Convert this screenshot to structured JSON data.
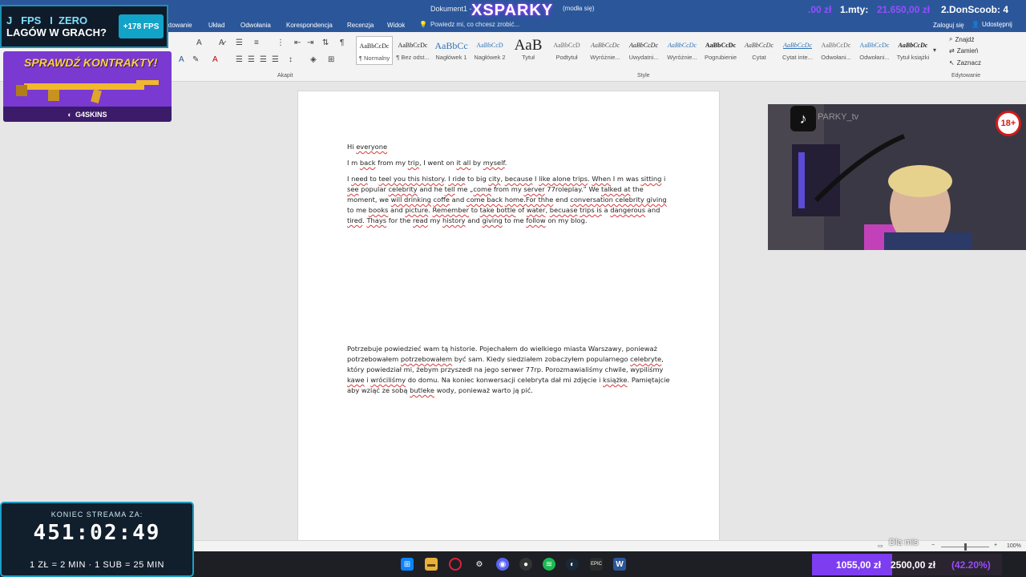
{
  "window": {
    "doc_title": "Dokument1 -",
    "doc_title_suffix": "(modła się)",
    "brand_overlay": "XSPARKY"
  },
  "ribbon_tabs": [
    {
      "label": "ktowanie"
    },
    {
      "label": "Układ"
    },
    {
      "label": "Odwołania"
    },
    {
      "label": "Korespondencja"
    },
    {
      "label": "Recenzja"
    },
    {
      "label": "Widok"
    }
  ],
  "tellme_placeholder": "Powiedz mi, co chcesz zrobić...",
  "account": {
    "login": "Zaloguj się",
    "share": "Udostępnij"
  },
  "ribbon_groups": {
    "paragraph": "Akapit",
    "styles": "Style",
    "editing": "Edytowanie"
  },
  "styles": [
    {
      "sample": "AaBbCcDc",
      "name": "¶ Normalny"
    },
    {
      "sample": "AaBbCcDc",
      "name": "¶ Bez odst..."
    },
    {
      "sample": "AaBbCc",
      "name": "Nagłówek 1"
    },
    {
      "sample": "AaBbCcD",
      "name": "Nagłówek 2"
    },
    {
      "sample": "AaB",
      "name": "Tytuł"
    },
    {
      "sample": "AaBbCcD",
      "name": "Podtytuł"
    },
    {
      "sample": "AaBbCcDc",
      "name": "Wyróżnie..."
    },
    {
      "sample": "AaBbCcDc",
      "name": "Uwydatni..."
    },
    {
      "sample": "AaBbCcDc",
      "name": "Wyróżnie..."
    },
    {
      "sample": "AaBbCcDc",
      "name": "Pogrubienie"
    },
    {
      "sample": "AaBbCcDc",
      "name": "Cytat"
    },
    {
      "sample": "AaBbCcDc",
      "name": "Cytat inte..."
    },
    {
      "sample": "AaBbCcDc",
      "name": "Odwołani..."
    },
    {
      "sample": "AaBbCcDc",
      "name": "Odwołani..."
    },
    {
      "sample": "AaBbCcDc",
      "name": "Tytuł książki"
    }
  ],
  "editing": {
    "find": "Znajdź",
    "replace": "Zamień",
    "select": "Zaznacz"
  },
  "document": {
    "p1": [
      "Hi ",
      {
        "t": "everyone",
        "sq": true
      }
    ],
    "p2": [
      "I m ",
      {
        "t": "back",
        "sq": true
      },
      " from my ",
      {
        "t": "trip",
        "sq": true
      },
      ", I went on ",
      {
        "t": "it all",
        "sq": true
      },
      " by ",
      {
        "t": "myself",
        "sq": true
      },
      "."
    ],
    "p3": [
      "I ",
      {
        "t": "need",
        "sq": true
      },
      " to ",
      {
        "t": "teel you this history",
        "sq": true
      },
      ". ",
      {
        "t": "I ride",
        "sq": true
      },
      " to big ",
      {
        "t": "city",
        "sq": true
      },
      ", ",
      {
        "t": "because",
        "sq": true
      },
      " I ",
      {
        "t": "like alone trips",
        "sq": true
      },
      ". ",
      {
        "t": "When",
        "sq": true
      },
      " I m was ",
      {
        "t": "sitting",
        "sq": true
      },
      " i ",
      {
        "t": "see",
        "sq": true
      },
      " popular ",
      {
        "t": "celebrity",
        "sq": true
      },
      " and he ",
      {
        "t": "tell",
        "sq": true
      },
      " me „",
      {
        "t": "come",
        "sq": true
      },
      " from my ",
      {
        "t": "server",
        "sq": true
      },
      " 77roleplay.” We ",
      {
        "t": "talked at",
        "sq": true
      },
      " the moment, we ",
      {
        "t": "will drinking",
        "sq": true
      },
      " ",
      {
        "t": "coffe",
        "sq": true
      },
      " and ",
      {
        "t": "come back",
        "sq": true
      },
      " ",
      {
        "t": "home.For thhe",
        "sq": true
      },
      " end ",
      {
        "t": "conversation celebrity giving",
        "sq": true
      },
      " to me ",
      {
        "t": "books",
        "sq": true
      },
      " and ",
      {
        "t": "picture",
        "sq": true
      },
      ". ",
      {
        "t": "Remember",
        "sq": true
      },
      " to ",
      {
        "t": "take bottle",
        "sq": true
      },
      " of ",
      {
        "t": "water",
        "sq": true
      },
      ", ",
      {
        "t": "becuase",
        "sq": true
      },
      " ",
      {
        "t": "trips is",
        "sq": true
      },
      " a ",
      {
        "t": "dangerous",
        "sq": true
      },
      " and ",
      {
        "t": "tired",
        "sq": true
      },
      ". ",
      {
        "t": "Thays",
        "sq": true
      },
      " for the ",
      {
        "t": "read",
        "sq": true
      },
      " my ",
      {
        "t": "history",
        "sq": true
      },
      " and ",
      {
        "t": "giving",
        "sq": true
      },
      " to me ",
      {
        "t": "follow",
        "sq": true
      },
      " on my blog."
    ],
    "p4": [
      "Potrzebuje powiedzieć wam tą historie. Pojechałem do wielkiego miasta Warszawy, ponieważ potrzebowałem ",
      {
        "t": "potrzebowałem",
        "sq": true
      },
      " być sam.  Kiedy siedziałem zobaczyłem popularnego ",
      {
        "t": "celebryte",
        "sq": true
      },
      ", który powiedział mi, żebym przyszedł na jego serwer 77rp. Porozmawialiśmy chwile, wypiliśmy ",
      {
        "t": "kawe",
        "sq": true
      },
      " i ",
      {
        "t": "wróciliśmy",
        "sq": true
      },
      " do domu.  Na koniec konwersacji celebryta dał mi zdjęcie i ",
      {
        "t": "książke",
        "sq": true
      },
      ". Pamiętajcie aby wziąć ze sobą ",
      {
        "t": "butleke",
        "sq": true
      },
      " wody, ponieważ warto ją pić."
    ]
  },
  "statusbar": {
    "zoom": "100%"
  },
  "overlays": {
    "fps_promo": {
      "line1": "J   FPS   I  ZERO",
      "line2": "LAGÓW  W GRACH?",
      "badge": "+178 FPS"
    },
    "kontrakty": {
      "title": "SPRAWDŹ KONTRAKTY!",
      "footer": "G4SKINS"
    },
    "top_donors": {
      "amount1": ".00 zł",
      "rank1": "1.mty:",
      "amount2": "21.650,00 zł",
      "rank2": "2.DonScoob: 4"
    },
    "webcam": {
      "rating_badge": "18+",
      "channel": "PARKY_tv"
    },
    "timer": {
      "label": "KONIEC STREAMA ZA:",
      "value": "451:02:49",
      "rates": "1 ZŁ = 2 MIN · 1 SUB = 25 MIN"
    },
    "goal": {
      "current": "1055,00 zł",
      "target": "2500,00 zł",
      "percent_text": "(42.20%)",
      "fraction": 0.422
    },
    "caption": "Dla mis"
  },
  "colors": {
    "word_blue": "#2b579a",
    "spell_red": "#d63b3b",
    "accent_purple": "#7d3df0",
    "accent_cyan": "#1a9fc6"
  },
  "taskbar": {
    "icons": [
      "windows-start-icon",
      "file-explorer-icon",
      "opera-gx-icon",
      "settings-icon",
      "discord-icon",
      "github-icon",
      "spotify-icon",
      "steam-icon",
      "epic-games-icon",
      "word-icon"
    ]
  }
}
